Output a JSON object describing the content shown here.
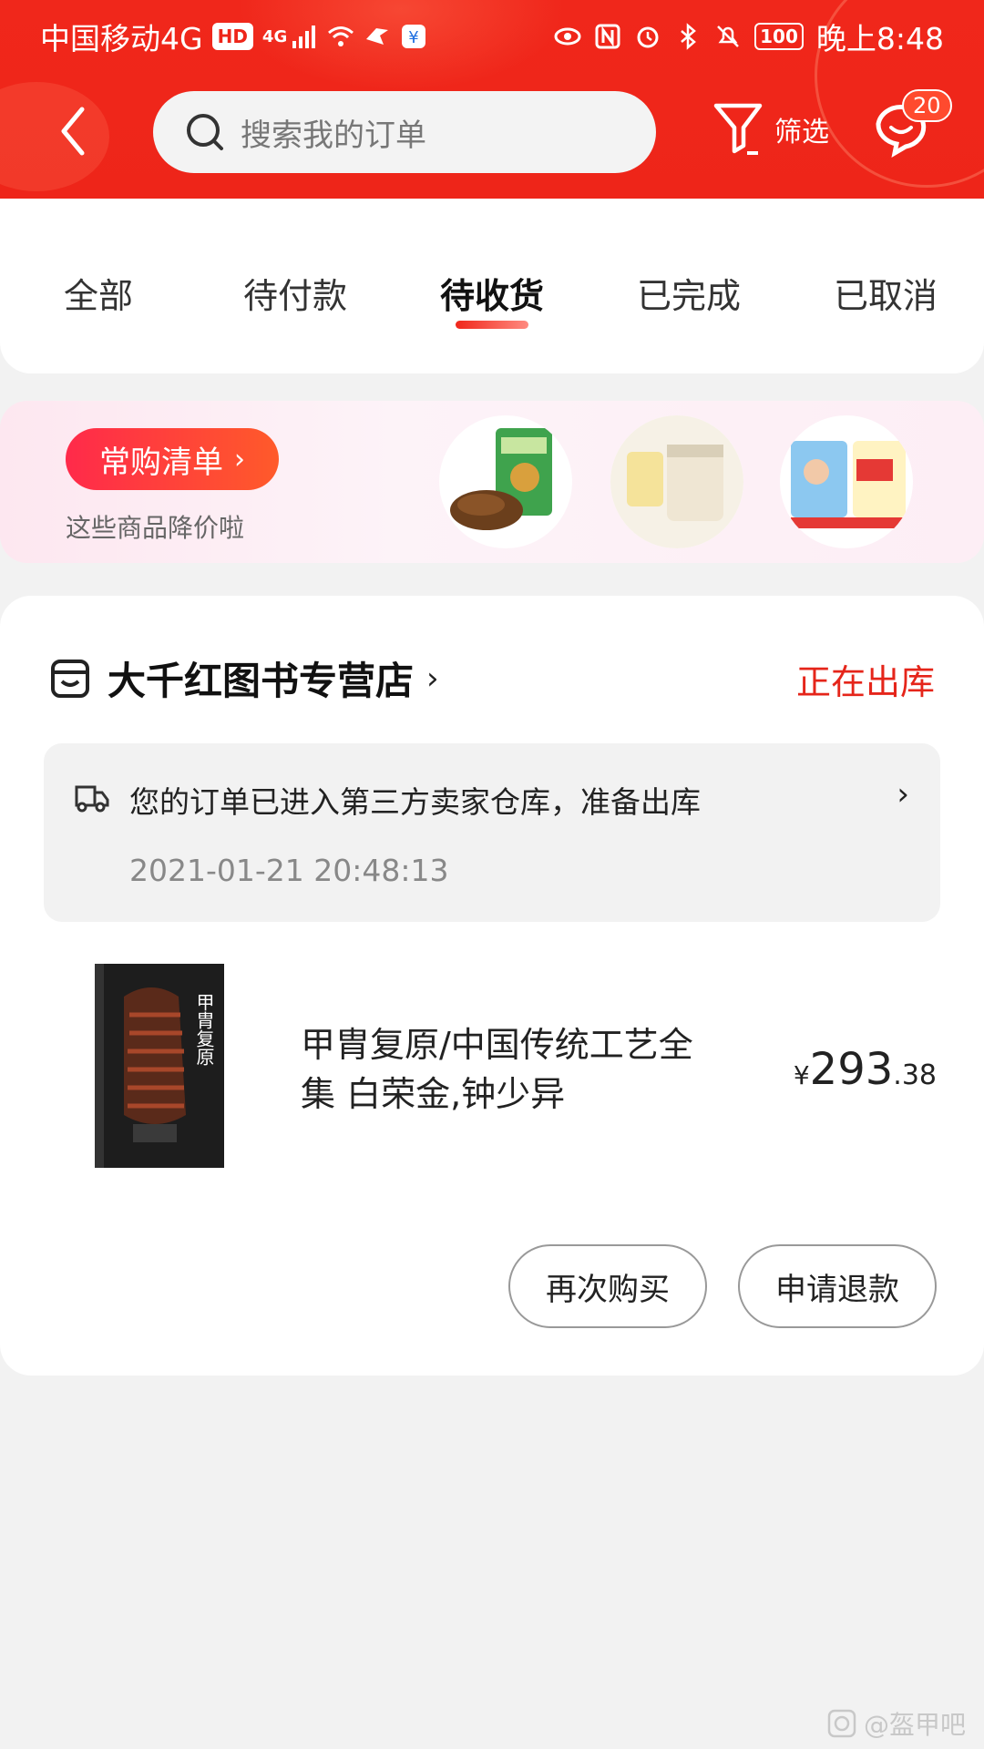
{
  "status_bar": {
    "carrier": "中国移动4G",
    "hd": "HD",
    "net": "4G",
    "battery": "100",
    "time": "晚上8:48"
  },
  "top_bar": {
    "search_placeholder": "搜索我的订单",
    "filter_label": "筛选",
    "message_badge": "20"
  },
  "tabs": [
    {
      "label": "全部",
      "active": false
    },
    {
      "label": "待付款",
      "active": false
    },
    {
      "label": "待收货",
      "active": true
    },
    {
      "label": "已完成",
      "active": false
    },
    {
      "label": "已取消",
      "active": false
    }
  ],
  "banner": {
    "title": "常购清单",
    "subtitle": "这些商品降价啦"
  },
  "order": {
    "shop_name": "大千红图书专营店",
    "status": "正在出库",
    "tracking_text": "您的订单已进入第三方卖家仓库，准备出库",
    "tracking_time": "2021-01-21 20:48:13",
    "item_title": "甲胄复原/中国传统工艺全集 白荣金,钟少异",
    "price_currency": "¥",
    "price_int": "293",
    "price_dec": ".38",
    "buttons": [
      "再次购买",
      "申请退款"
    ]
  },
  "book_cover_text": "甲胄复原",
  "watermark": "@盔甲吧",
  "colors": {
    "accent": "#ee2519",
    "status_red": "#e5251a"
  }
}
